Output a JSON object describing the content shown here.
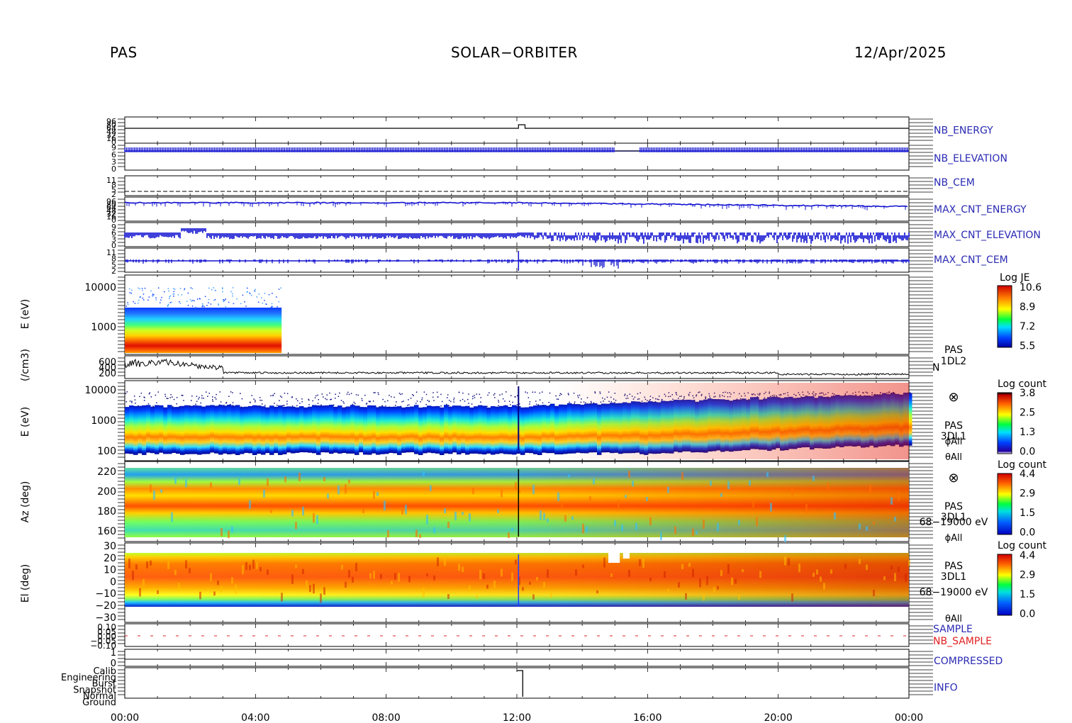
{
  "header": {
    "instrument": "PAS",
    "mission": "SOLAR−ORBITER",
    "date": "12/Apr/2025"
  },
  "time_axis": {
    "ticks": [
      "00:00",
      "04:00",
      "08:00",
      "12:00",
      "16:00",
      "20:00",
      "00:00"
    ]
  },
  "chart_data": [
    {
      "type": "line",
      "id": "nb_energy",
      "ylabel": "NB_ENERGY",
      "tick_labels": [
        "96",
        "80",
        "64",
        "48",
        "32",
        "16",
        "0"
      ]
    },
    {
      "type": "line",
      "id": "nb_elevation",
      "ylabel": "NB_ELEVATION",
      "tick_labels": [
        "9",
        "6",
        "3",
        "0"
      ]
    },
    {
      "type": "line",
      "id": "nb_cem",
      "ylabel": "NB_CEM",
      "tick_labels": [
        "11",
        "8",
        "5",
        "2"
      ]
    },
    {
      "type": "line",
      "id": "max_cnt_energy",
      "ylabel": "MAX_CNT_ENERGY",
      "tick_labels": [
        "96",
        "80",
        "64",
        "48",
        "32",
        "16",
        "0"
      ]
    },
    {
      "type": "line",
      "id": "max_cnt_elevation",
      "ylabel": "MAX_CNT_ELEVATION",
      "tick_labels": [
        "9",
        "6",
        "3",
        "0"
      ]
    },
    {
      "type": "line",
      "id": "max_cnt_cem",
      "ylabel": "MAX_CNT_CEM",
      "tick_labels": [
        "11",
        "8",
        "5",
        "2"
      ]
    },
    {
      "type": "heatmap",
      "id": "pas_1dl2_spectrogram",
      "ylabel": "E (eV)",
      "y_tick_labels": [
        "10000",
        "1000"
      ],
      "x_range_hours": [
        0,
        4.8
      ],
      "colorbar": {
        "title": "Log JE",
        "ticks": [
          "10.6",
          "8.9",
          "7.2",
          "5.5"
        ]
      }
    },
    {
      "type": "line",
      "id": "pas_1dl2_density",
      "ylabel": "(/cm3)",
      "tick_labels": [
        "600",
        "400",
        "200"
      ],
      "right_label": "N",
      "product": [
        "PAS",
        "1DL2"
      ]
    },
    {
      "type": "heatmap",
      "id": "pas_3dl1_energy",
      "ylabel": "E (eV)",
      "y_tick_labels": [
        "10000",
        "1000",
        "100"
      ],
      "colorbar": {
        "title": "Log count",
        "ticks": [
          "3.8",
          "2.5",
          "1.3",
          "0.0"
        ]
      },
      "labels": [
        "⊗",
        "PAS",
        "3DL1",
        "ϕAll",
        "θAll"
      ]
    },
    {
      "type": "heatmap",
      "id": "pas_3dl1_azimuth",
      "ylabel": "Az (deg)",
      "y_tick_labels": [
        "220",
        "200",
        "180",
        "160"
      ],
      "colorbar": {
        "title": "Log count",
        "ticks": [
          "4.4",
          "2.9",
          "1.5",
          "0.0"
        ]
      },
      "labels": [
        "⊗",
        "PAS",
        "3DL1",
        "68−19000 eV",
        "ϕAll"
      ]
    },
    {
      "type": "heatmap",
      "id": "pas_3dl1_elevation",
      "ylabel": "El (deg)",
      "y_tick_labels": [
        "30",
        "20",
        "10",
        "0",
        "−10",
        "−20",
        "−30"
      ],
      "colorbar": {
        "title": "Log count",
        "ticks": [
          "4.4",
          "2.9",
          "1.5",
          "0.0"
        ]
      },
      "labels": [
        "PAS",
        "3DL1",
        "68−19000 eV",
        "θAll"
      ]
    },
    {
      "type": "line",
      "id": "sample",
      "tick_labels": [
        "0.10",
        "0.05",
        "0.00",
        "−0.05",
        "−0.10"
      ],
      "series_labels": [
        "SAMPLE",
        "NB_SAMPLE"
      ]
    },
    {
      "type": "line",
      "id": "compressed",
      "ylabel": "COMPRESSED",
      "tick_labels": [
        "1",
        "0"
      ]
    },
    {
      "type": "line",
      "id": "info",
      "ylabel": "INFO",
      "tick_labels": [
        "Calib",
        "Engineering",
        "Burst",
        "Snapshot",
        "Normal",
        "Ground"
      ]
    }
  ],
  "colors": {
    "blue_label": "#2a2ab4",
    "red_label": "#e02020",
    "trace_blue": "#1010d0"
  }
}
